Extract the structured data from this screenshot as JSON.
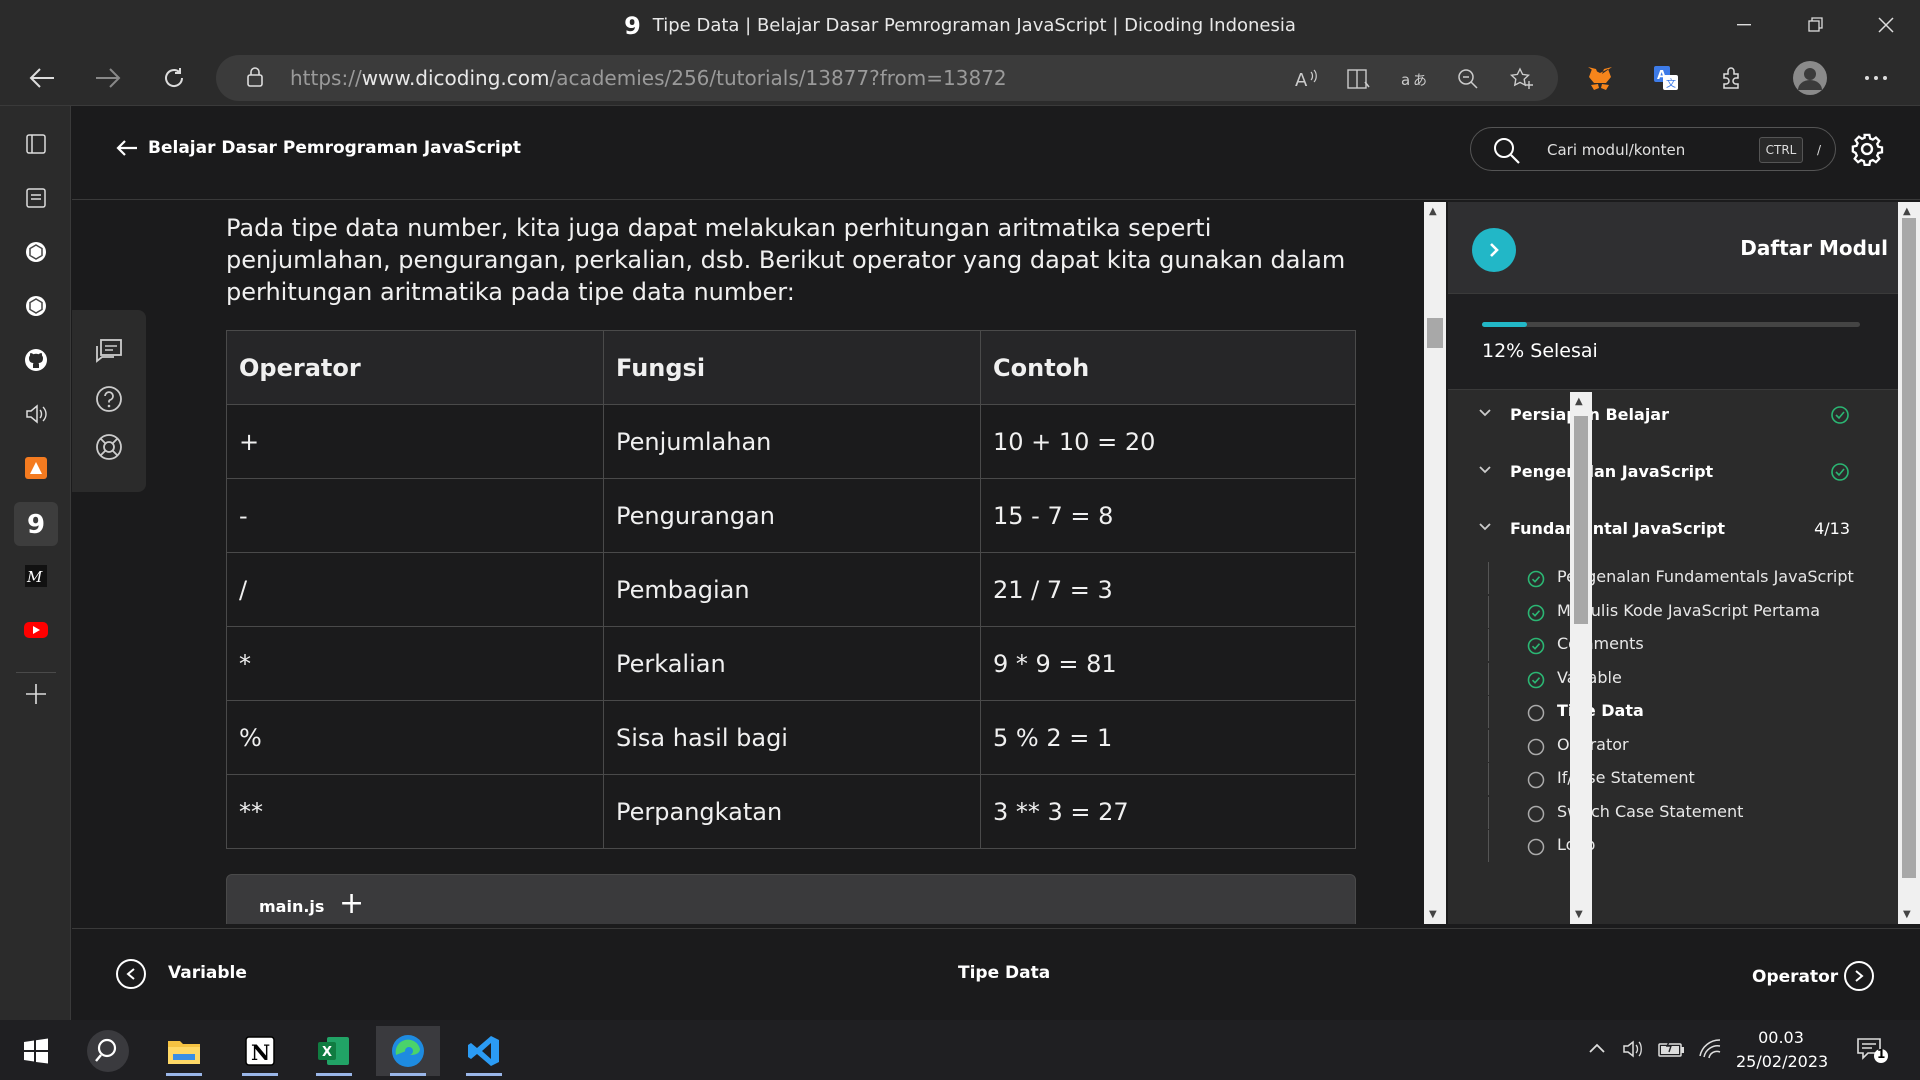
{
  "window": {
    "title": "Tipe Data | Belajar Dasar Pemrograman JavaScript | Dicoding Indonesia",
    "favicon_glyph": "9"
  },
  "address_bar": {
    "url_prefix": "https://",
    "url_domain": "www.dicoding.com",
    "url_path": "/academies/256/tutorials/13877?from=13872"
  },
  "header": {
    "back_label": "Belajar Dasar Pemrograman JavaScript",
    "search_placeholder": "Cari modul/konten",
    "kbd_ctrl": "CTRL",
    "kbd_slash": "/"
  },
  "content": {
    "intro": "Pada tipe data number, kita juga dapat melakukan perhitungan aritmatika seperti penjumlahan, pengurangan, perkalian, dsb. Berikut operator yang dapat kita gunakan dalam perhitungan aritmatika pada tipe data number:",
    "table_headers": [
      "Operator",
      "Fungsi",
      "Contoh"
    ],
    "table_rows": [
      [
        "+",
        "Penjumlahan",
        "10 + 10 = 20"
      ],
      [
        "-",
        "Pengurangan",
        "15 - 7 = 8"
      ],
      [
        "/",
        "Pembagian",
        "21 / 7 = 3"
      ],
      [
        "*",
        "Perkalian",
        "9 * 9 = 81"
      ],
      [
        "%",
        "Sisa hasil bagi",
        "5 % 2 = 1"
      ],
      [
        "**",
        "Perpangkatan",
        "3 ** 3 = 27"
      ]
    ],
    "code_tab": "main.js",
    "code_add": "+"
  },
  "module_panel": {
    "title": "Daftar Modul",
    "progress_fraction": 0.12,
    "progress_label": "12% Selesai",
    "sections": [
      {
        "name": "Persiapan Belajar",
        "status": "done"
      },
      {
        "name": "Pengenalan JavaScript",
        "status": "done"
      },
      {
        "name": "Fundamental JavaScript",
        "count": "4/13"
      }
    ],
    "items": [
      {
        "name": "Pengenalan Fundamentals JavaScript",
        "done": true
      },
      {
        "name": "Menulis Kode JavaScript Pertama",
        "done": true
      },
      {
        "name": "Comments",
        "done": true
      },
      {
        "name": "Variable",
        "done": true
      },
      {
        "name": "Tipe Data",
        "done": false,
        "active": true
      },
      {
        "name": "Operator",
        "done": false
      },
      {
        "name": "If/Else Statement",
        "done": false
      },
      {
        "name": "Switch Case Statement",
        "done": false
      },
      {
        "name": "Loop",
        "done": false
      }
    ]
  },
  "footer": {
    "prev_label": "Variable",
    "current_label": "Tipe Data",
    "next_label": "Operator"
  },
  "taskbar": {
    "time": "00.03",
    "date": "25/02/2023",
    "notification_count": "1"
  },
  "colors": {
    "accent": "#22b7c7",
    "done": "#2bb673"
  }
}
